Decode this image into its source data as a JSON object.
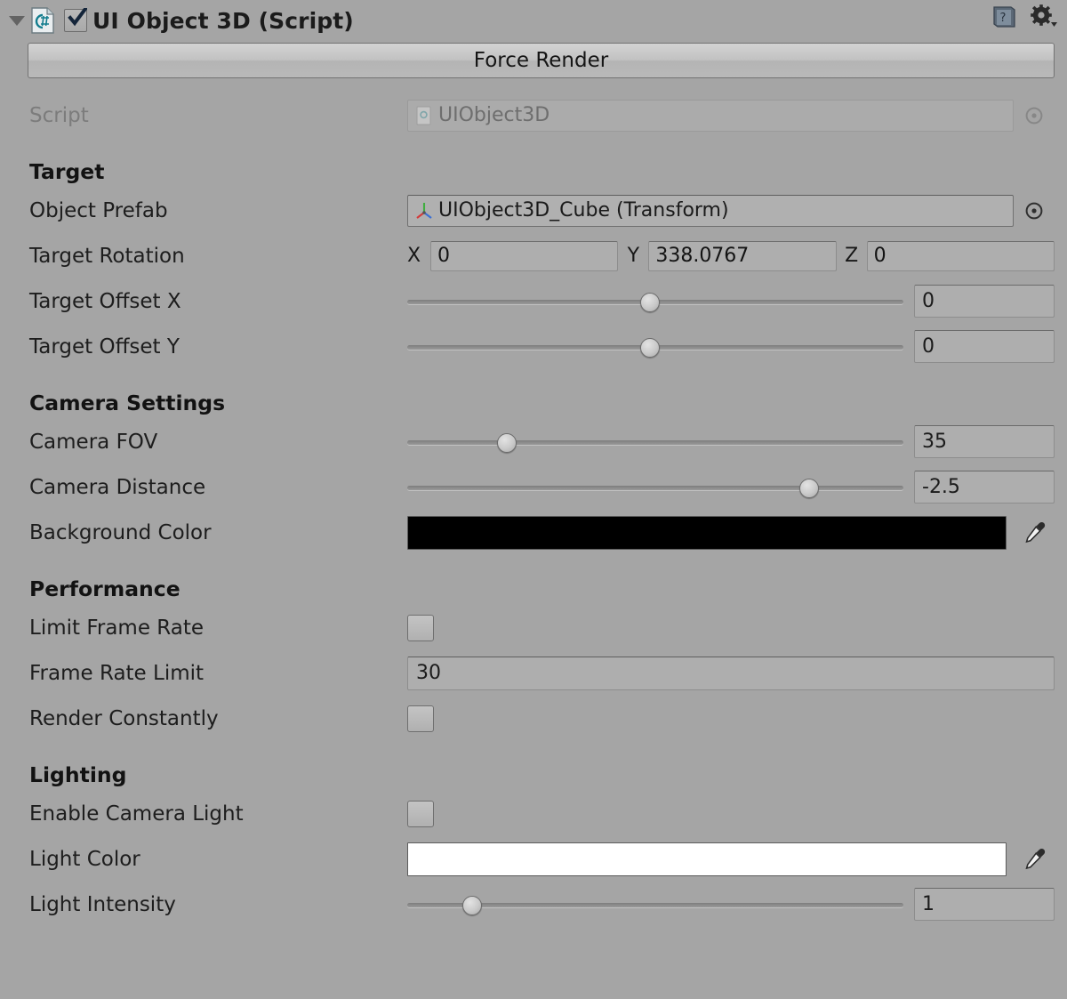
{
  "header": {
    "title": "UI Object 3D (Script)",
    "enabled": true,
    "foldout_open": true,
    "script_icon": "csharp-script-icon",
    "help_icon": "help-book-icon",
    "gear_icon": "settings-gear-icon"
  },
  "toolbar": {
    "force_render_label": "Force Render"
  },
  "script_row": {
    "label": "Script",
    "value": "UIObject3D",
    "icon": "script-asset-icon",
    "picker_icon": "object-picker-icon",
    "disabled": true
  },
  "sections": {
    "target": {
      "heading": "Target",
      "object_prefab": {
        "label": "Object Prefab",
        "value": "UIObject3D_Cube (Transform)",
        "icon": "transform-gizmo-icon",
        "picker_icon": "object-picker-icon"
      },
      "target_rotation": {
        "label": "Target Rotation",
        "axes": [
          {
            "axis": "X",
            "value": "0"
          },
          {
            "axis": "Y",
            "value": "338.0767"
          },
          {
            "axis": "Z",
            "value": "0"
          }
        ]
      },
      "target_offset_x": {
        "label": "Target Offset X",
        "value": "0",
        "slider_percent": 49
      },
      "target_offset_y": {
        "label": "Target Offset Y",
        "value": "0",
        "slider_percent": 49
      }
    },
    "camera": {
      "heading": "Camera Settings",
      "camera_fov": {
        "label": "Camera FOV",
        "value": "35",
        "slider_percent": 20
      },
      "camera_distance": {
        "label": "Camera Distance",
        "value": "-2.5",
        "slider_percent": 81
      },
      "background_color": {
        "label": "Background Color",
        "color": "#000000",
        "eyedropper_icon": "eyedropper-icon"
      }
    },
    "performance": {
      "heading": "Performance",
      "limit_frame_rate": {
        "label": "Limit Frame Rate",
        "checked": false
      },
      "frame_rate_limit": {
        "label": "Frame Rate Limit",
        "value": "30"
      },
      "render_constantly": {
        "label": "Render Constantly",
        "checked": false
      }
    },
    "lighting": {
      "heading": "Lighting",
      "enable_camera_light": {
        "label": "Enable Camera Light",
        "checked": false
      },
      "light_color": {
        "label": "Light Color",
        "color": "#FFFFFF",
        "eyedropper_icon": "eyedropper-icon"
      },
      "light_intensity": {
        "label": "Light Intensity",
        "value": "1",
        "slider_percent": 13
      }
    }
  },
  "colors": {
    "panel_background": "#a5a5a5",
    "text": "#1b1b1b",
    "disabled_text": "#7c7c7c",
    "field_background": "#aeaeae"
  }
}
